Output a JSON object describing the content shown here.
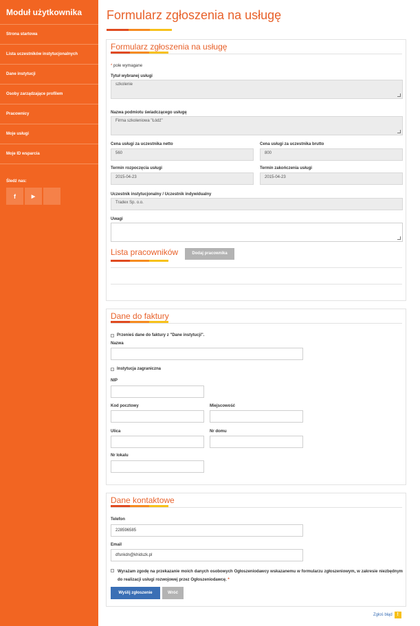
{
  "sidebar": {
    "title": "Moduł użytkownika",
    "items": [
      {
        "label": "Strona startowa"
      },
      {
        "label": "Lista uczestników instytucjonalnych"
      },
      {
        "label": "Dane instytucji"
      },
      {
        "label": "Osoby zarządzające profilem"
      },
      {
        "label": "Pracownicy"
      },
      {
        "label": "Moje usługi"
      },
      {
        "label": "Moje ID wsparcia"
      }
    ],
    "follow_label": "Śledź nas:",
    "social": [
      "f",
      "▶",
      ""
    ]
  },
  "page": {
    "title": "Formularz zgłoszenia na usługę"
  },
  "form": {
    "title": "Formularz zgłoszenia na usługę",
    "required_note": "pole wymagane",
    "service_title_label": "Tytuł wybranej usługi",
    "service_title_value": "szkolenie",
    "provider_label": "Nazwa podmiotu świadczącego usługę",
    "provider_value": "Firma szkoleniowa \"Łódź\"",
    "net_price_label": "Cena usługi za uczestnika netto",
    "net_price_value": "560",
    "gross_price_label": "Cena usługi za uczestnika brutto",
    "gross_price_value": "800",
    "start_label": "Termin rozpoczęcia usługi",
    "start_value": "2015-04-23",
    "end_label": "Termin zakończenia usługi",
    "end_value": "2015-04-23",
    "participant_label": "Uczestnik instytucjonalny / Uczestnik indywidualny",
    "participant_value": "Tradex Sp. o.o.",
    "notes_label": "Uwagi",
    "notes_value": "",
    "employees_title": "Lista pracowników",
    "add_employee_label": "Dodaj pracownika"
  },
  "invoice": {
    "title": "Dane do faktury",
    "copy_label": "Przenieś dane do faktury z \"Dane instytucji\".",
    "name_label": "Nazwa",
    "foreign_label": "Instytucja zagraniczna",
    "nip_label": "NIP",
    "postal_label": "Kod pocztowy",
    "city_label": "Miejscowość",
    "street_label": "Ulica",
    "house_label": "Nr domu",
    "flat_label": "Nr lokalu"
  },
  "contact": {
    "title": "Dane kontaktowe",
    "phone_label": "Telefon",
    "phone_value": "228596585",
    "email_label": "Email",
    "email_value": "dfsnkdn@khidszk.pl",
    "consent_text": "Wyrażam zgodę na przekazanie moich danych osobowych Ogłoszeniodawcy wskazanemu w formularzu zgłoszeniowym, w zakresie niezbędnym do realizacji usługi rozwojowej przez Ogłoszeniodawcę.",
    "consent_required": "*",
    "submit_label": "Wyślij zgłoszenie",
    "back_label": "Wróć"
  },
  "footer": {
    "report_label": "Zgłoś błąd"
  },
  "colors": {
    "accent": "#f26522",
    "title": "#e8612a",
    "primary_button": "#3a6fb5",
    "secondary_button": "#b3b3b3"
  }
}
